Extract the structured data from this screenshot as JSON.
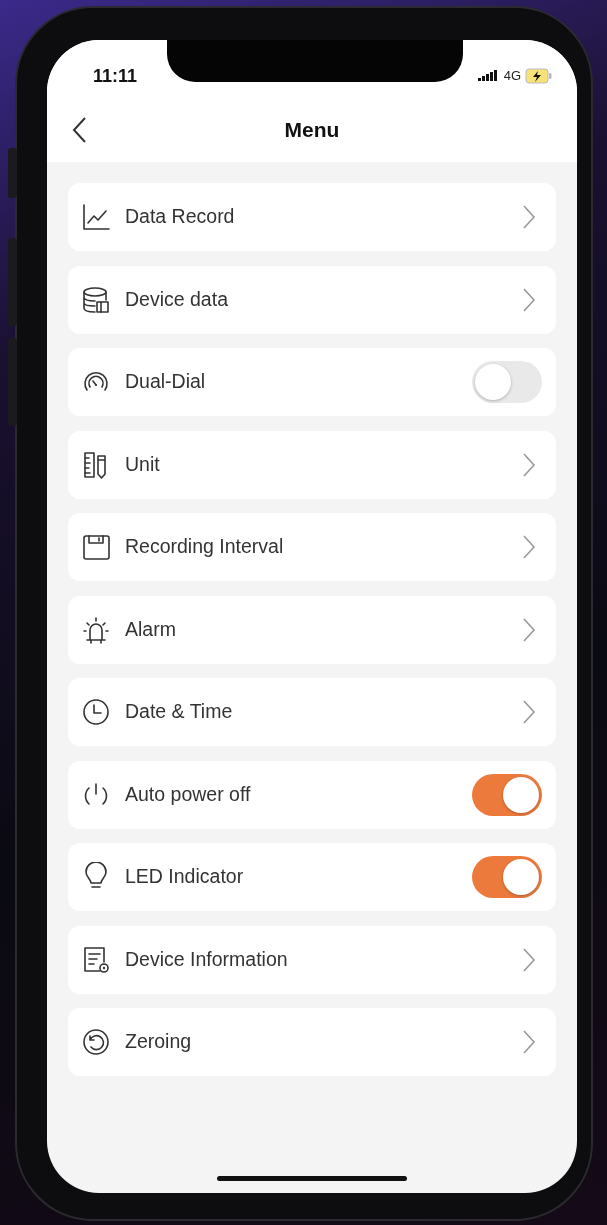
{
  "status_bar": {
    "time": "11:11",
    "network": "4G"
  },
  "header": {
    "title": "Menu"
  },
  "items": [
    {
      "label": "Data Record",
      "kind": "link"
    },
    {
      "label": "Device data",
      "kind": "link"
    },
    {
      "label": "Dual-Dial",
      "kind": "toggle",
      "on": false
    },
    {
      "label": "Unit",
      "kind": "link"
    },
    {
      "label": "Recording Interval",
      "kind": "link"
    },
    {
      "label": "Alarm",
      "kind": "link"
    },
    {
      "label": "Date & Time",
      "kind": "link"
    },
    {
      "label": "Auto power off",
      "kind": "toggle",
      "on": true
    },
    {
      "label": "LED Indicator",
      "kind": "toggle",
      "on": true
    },
    {
      "label": "Device Information",
      "kind": "link"
    },
    {
      "label": "Zeroing",
      "kind": "link"
    }
  ]
}
